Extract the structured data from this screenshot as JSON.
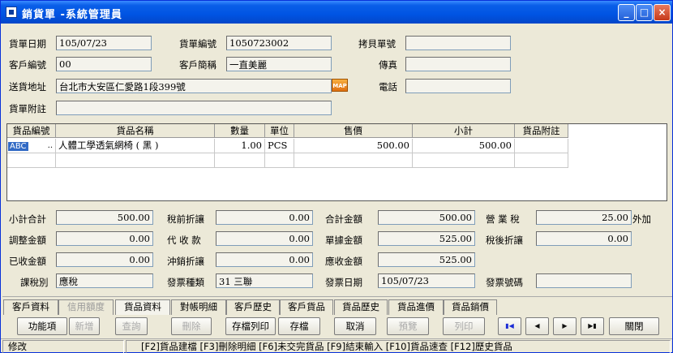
{
  "window": {
    "title": "銷貨單 -系統管理員",
    "minimize": "_",
    "maximize": "□",
    "close": "×"
  },
  "header": {
    "date_label": "貨單日期",
    "date_value": "105/07/23",
    "order_no_label": "貨單編號",
    "order_no_value": "1050723002",
    "copy_no_label": "拷貝單號",
    "copy_no_value": "",
    "customer_id_label": "客戶編號",
    "customer_id_value": "00",
    "customer_short_label": "客戶簡稱",
    "customer_short_value": "一直美麗",
    "fax_label": "傳真",
    "fax_value": "",
    "address_label": "送貨地址",
    "address_value": "台北市大安區仁愛路1段399號",
    "map_label": "MAP",
    "phone_label": "電話",
    "phone_value": "",
    "note_label": "貨單附註",
    "note_value": ""
  },
  "grid": {
    "columns": [
      "貨品編號",
      "貨品名稱",
      "數量",
      "單位",
      "售價",
      "小計",
      "貨品附註"
    ],
    "rows": [
      {
        "code": "ABC",
        "lookup": "..",
        "name": "人體工學透氣網椅 ( 黑 )",
        "qty": "1.00",
        "unit": "PCS",
        "price": "500.00",
        "subtotal": "500.00",
        "note": ""
      }
    ]
  },
  "totals": {
    "subtotal_label": "小計合計",
    "subtotal_value": "500.00",
    "pre_tax_discount_label": "稅前折讓",
    "pre_tax_discount_value": "0.00",
    "total_amount_label": "合計金額",
    "total_amount_value": "500.00",
    "tax_label": "營 業 稅",
    "tax_value": "25.00",
    "tax_suffix": "外加",
    "adjust_label": "調整金額",
    "adjust_value": "0.00",
    "collect_label": "代 收 款",
    "collect_value": "0.00",
    "doc_amount_label": "單據金額",
    "doc_amount_value": "525.00",
    "post_tax_discount_label": "稅後折讓",
    "post_tax_discount_value": "0.00",
    "received_label": "已收金額",
    "received_value": "0.00",
    "offset_label": "沖銷折讓",
    "offset_value": "0.00",
    "receivable_label": "應收金額",
    "receivable_value": "525.00",
    "tax_type_label": "課稅別",
    "tax_type_value": "應稅",
    "invoice_type_label": "發票種類",
    "invoice_type_value": "31 三聯",
    "invoice_date_label": "發票日期",
    "invoice_date_value": "105/07/23",
    "invoice_no_label": "發票號碼",
    "invoice_no_value": ""
  },
  "tabs": [
    {
      "label": "客戶資料",
      "enabled": true
    },
    {
      "label": "信用額度",
      "enabled": false
    },
    {
      "label": "貨品資料",
      "enabled": true
    },
    {
      "label": "對帳明細",
      "enabled": true
    },
    {
      "label": "客戶歷史",
      "enabled": true
    },
    {
      "label": "客戶貨品",
      "enabled": true
    },
    {
      "label": "貨品歷史",
      "enabled": true
    },
    {
      "label": "貨品進價",
      "enabled": true
    },
    {
      "label": "貨品銷價",
      "enabled": true
    }
  ],
  "toolbar": {
    "function": "功能項",
    "new": "新增",
    "query": "查詢",
    "delete": "刪除",
    "save_print": "存檔列印",
    "save": "存檔",
    "cancel": "取消",
    "preview": "預覽",
    "print": "列印",
    "close": "關閉"
  },
  "status": {
    "mode": "修改",
    "hints": "[F2]貨品建檔 [F3]刪除明細 [F6]未交完貨品 [F9]結束輸入 [F10]貨品速查 [F12]歷史貨品"
  }
}
